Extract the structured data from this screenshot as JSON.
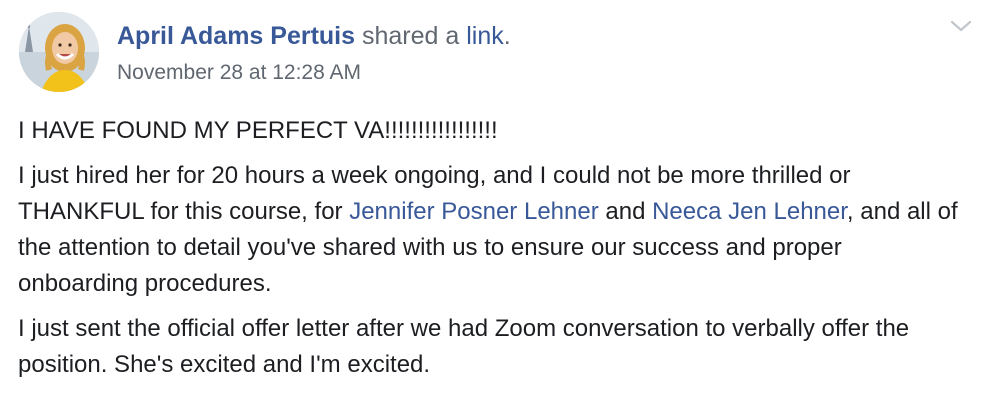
{
  "post": {
    "author": {
      "name": "April Adams Pertuis",
      "action_text": " shared a ",
      "link_word": "link",
      "punctuation": "."
    },
    "timestamp": "November 28 at 12:28 AM",
    "options_icon": "chevron-down-icon",
    "paragraphs": {
      "p1": "I HAVE FOUND MY PERFECT VA!!!!!!!!!!!!!!!!!",
      "p2": {
        "part1": "I just hired her for 20 hours a week ongoing, and I could not be more thrilled or THANKFUL for this course, for ",
        "mention1": "Jennifer Posner Lehner",
        "part2": " and ",
        "mention2": "Neeca Jen Lehner",
        "part3": ", and all of the attention to detail you've shared with us to ensure our success and proper onboarding procedures."
      },
      "p3": "I just sent the official offer letter after we had Zoom conversation to verbally offer the position. She's excited and I'm excited."
    }
  },
  "colors": {
    "link": "#385898",
    "meta": "#606770",
    "text": "#1c1e21"
  }
}
